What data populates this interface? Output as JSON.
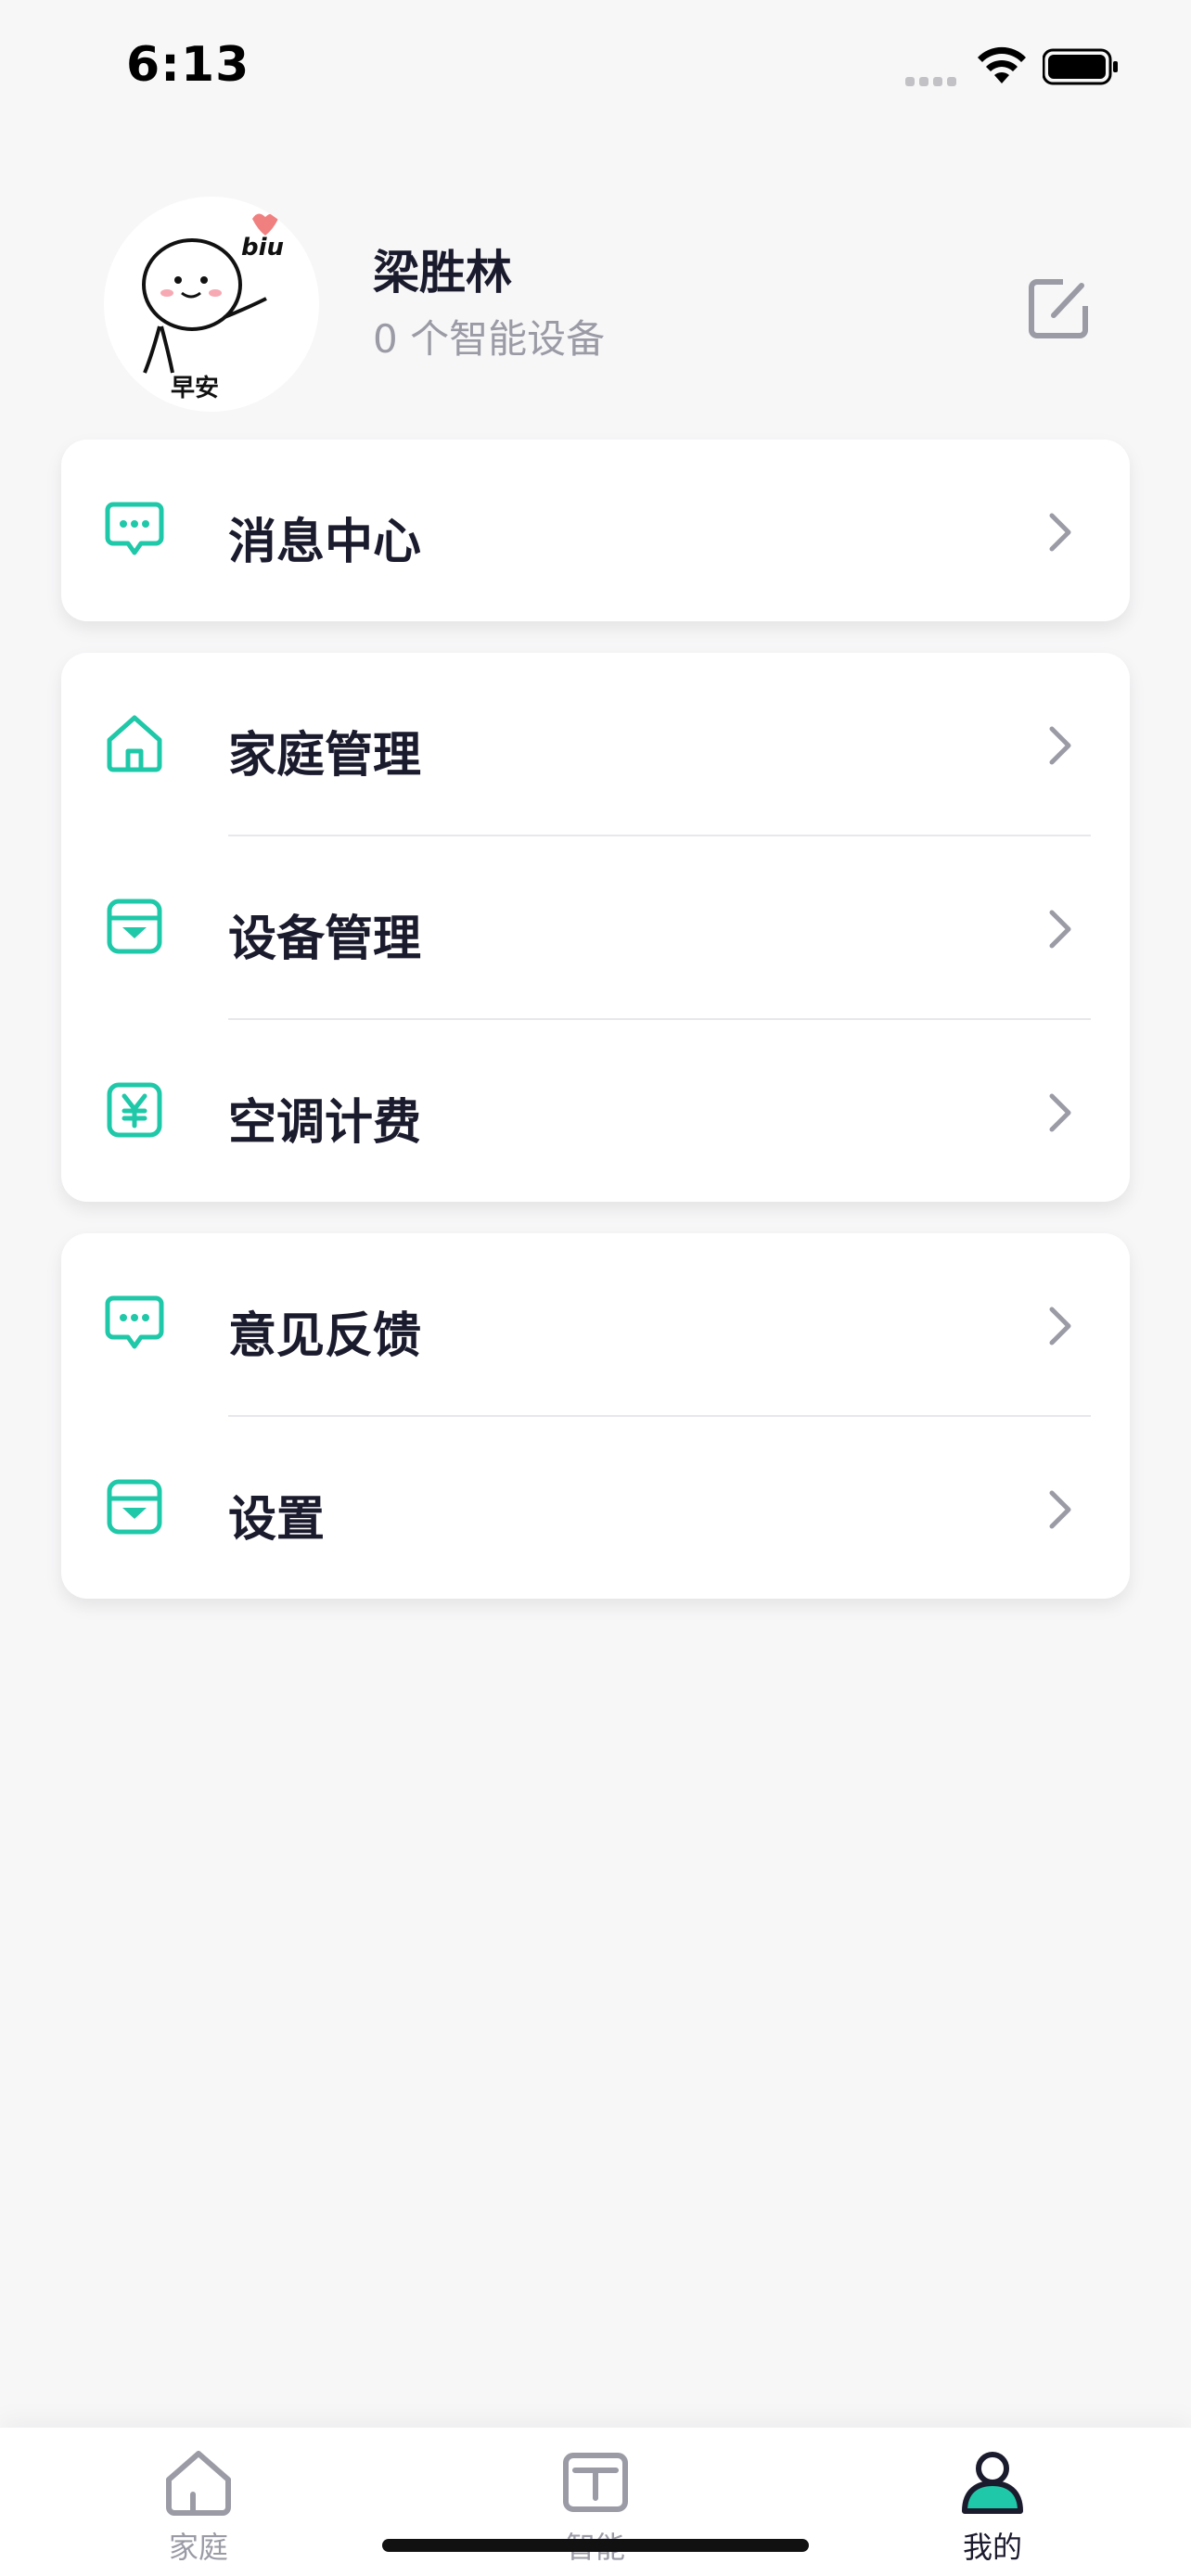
{
  "status_bar": {
    "time": "6:13"
  },
  "profile": {
    "avatar_stamp_text": "biu",
    "avatar_caption": "早安",
    "name": "梁胜林",
    "device_count": "0 个智能设备"
  },
  "cards": [
    {
      "items": [
        {
          "label": "消息中心",
          "icon": "chat-bubble-icon"
        }
      ]
    },
    {
      "items": [
        {
          "label": "家庭管理",
          "icon": "home-icon"
        },
        {
          "label": "设备管理",
          "icon": "device-box-icon"
        },
        {
          "label": "空调计费",
          "icon": "yuan-billing-icon"
        }
      ]
    },
    {
      "items": [
        {
          "label": "意见反馈",
          "icon": "chat-bubble-icon"
        },
        {
          "label": "设置",
          "icon": "device-box-icon"
        }
      ]
    }
  ],
  "tabbar": {
    "tabs": [
      {
        "label": "家庭",
        "icon": "home-outline-icon",
        "active": false
      },
      {
        "label": "智能",
        "icon": "cube-icon",
        "active": false
      },
      {
        "label": "我的",
        "icon": "person-icon",
        "active": true
      }
    ]
  },
  "colors": {
    "accent": "#1fc8a8",
    "text": "#1b1b2e",
    "muted": "#9b9ba6",
    "background": "#f7f7f8"
  }
}
